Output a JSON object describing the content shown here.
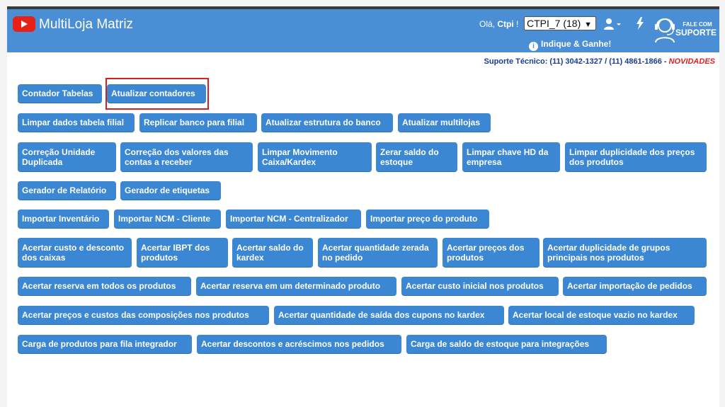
{
  "header": {
    "app_title": "MultiLoja Matriz",
    "greeting_prefix": "Olá, ",
    "greeting_user": "Ctpi",
    "greeting_suffix": " !",
    "store_selected": "CTPI_7 (18)",
    "referral": "Indique & Ganhe!",
    "support_small": "FALE COM",
    "support_big": "SUPORTE",
    "brand_color": "#4a8fd6"
  },
  "tech_support": {
    "label": "Suporte Técnico: (11) 3042-1327 / (11) 4861-1866 - ",
    "novidades": "NOVIDADES"
  },
  "buttons": [
    "Contador Tabelas",
    "Atualizar contadores",
    "Limpar dados tabela filial",
    "Replicar banco para filial",
    "Atualizar estrutura do banco",
    "Atualizar multilojas",
    "Correção Unidade Duplicada",
    "Correção dos valores das contas a receber",
    "Limpar Movimento Caixa/Kardex",
    "Zerar saldo do estoque",
    "Limpar chave HD da empresa",
    "Limpar duplicidade dos preços dos produtos",
    "Gerador de Relatório",
    "Gerador de etiquetas",
    "Importar Inventário",
    "Importar NCM - Cliente",
    "Importar NCM - Centralizador",
    "Importar preço do produto",
    "Acertar custo e desconto dos caixas",
    "Acertar IBPT dos produtos",
    "Acertar saldo do kardex",
    "Acertar quantidade zerada no pedido",
    "Acertar preços dos produtos",
    "Acertar duplicidade de grupos principais nos produtos",
    "Acertar reserva em todos os produtos",
    "Acertar reserva em um determinado produto",
    "Acertar custo inicial nos produtos",
    "Acertar importação de pedidos",
    "Acertar preços e custos das composições nos produtos",
    "Acertar quantidade de saída dos cupons no kardex",
    "Acertar local de estoque vazio no kardex",
    "Carga de produtos para fila integrador",
    "Acertar descontos e acréscimos nos pedidos",
    "Carga de saldo de estoque para integrações"
  ],
  "button_color": "#3b87d4",
  "highlight_color": "#d62020"
}
